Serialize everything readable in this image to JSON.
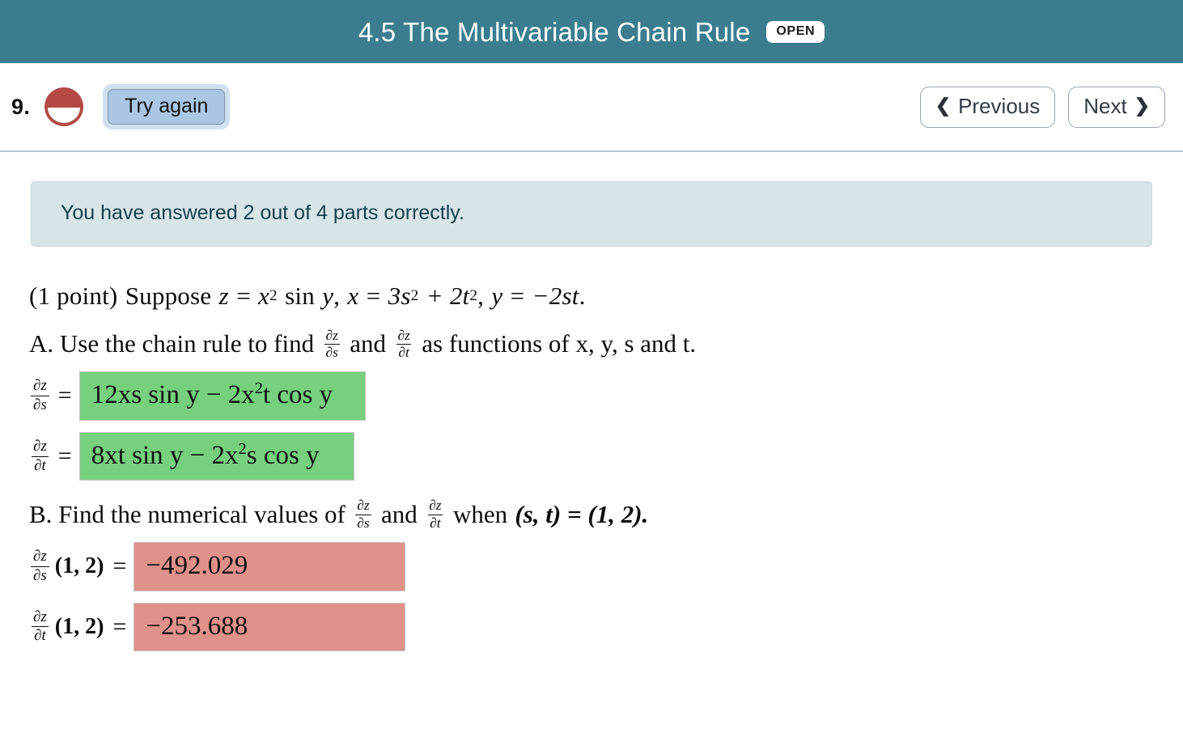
{
  "header": {
    "title": "4.5 The Multivariable Chain Rule",
    "badge": "OPEN"
  },
  "toolbar": {
    "problem_number": "9.",
    "status_icon": "half-filled-circle-icon",
    "status_color": "#b44a43",
    "try_again_label": "Try again",
    "previous_label": "Previous",
    "next_label": "Next",
    "previous_icon": "chevron-left-icon",
    "next_icon": "chevron-right-icon"
  },
  "alert": {
    "message": "You have answered 2 out of 4 parts correctly.",
    "background": "#d7e4e8",
    "text_color": "#16404c"
  },
  "problem": {
    "points": "(1 point)",
    "suppose_word": "Suppose",
    "z_lhs": "z",
    "z_rhs_base": "x",
    "z_rhs_exp": "2",
    "z_rhs_trig": "sin",
    "z_rhs_arg": "y",
    "x_lhs": "x",
    "x_rhs": "3s",
    "x_rhs_exp1": "2",
    "x_rhs_plus": "+ 2t",
    "x_rhs_exp2": "2",
    "y_lhs": "y",
    "y_rhs": "−2st",
    "period": "."
  },
  "partA": {
    "prefix": "A. Use the chain rule to find",
    "and_word": "and",
    "suffix": "as functions of x, y, s and t.",
    "deriv1": {
      "num": "∂z",
      "den": "∂s"
    },
    "deriv2": {
      "num": "∂z",
      "den": "∂t"
    },
    "answers": [
      {
        "lhs_num": "∂z",
        "lhs_den": "∂s",
        "equals": "=",
        "value_pre": "12xs sin y − 2x",
        "value_exp": "2",
        "value_post": "t cos y",
        "state": "correct"
      },
      {
        "lhs_num": "∂z",
        "lhs_den": "∂t",
        "equals": "=",
        "value_pre": "8xt sin y − 2x",
        "value_exp": "2",
        "value_post": "s cos y",
        "state": "correct"
      }
    ]
  },
  "partB": {
    "prefix": "B. Find the numerical values of",
    "and_word": "and",
    "when_word": "when",
    "point": "(s, t) = (1, 2).",
    "deriv1": {
      "num": "∂z",
      "den": "∂s"
    },
    "deriv2": {
      "num": "∂z",
      "den": "∂t"
    },
    "answers": [
      {
        "lhs_num": "∂z",
        "lhs_den": "∂s",
        "args": "(1, 2)",
        "equals": "=",
        "value": "−492.029",
        "state": "incorrect"
      },
      {
        "lhs_num": "∂z",
        "lhs_den": "∂t",
        "args": "(1, 2)",
        "equals": "=",
        "value": "−253.688",
        "state": "incorrect"
      }
    ]
  },
  "colors": {
    "header_teal": "#3b7d8f",
    "correct_green": "#76d07e",
    "incorrect_salmon": "#e0918a",
    "try_again_blue": "#a9c7e3"
  }
}
